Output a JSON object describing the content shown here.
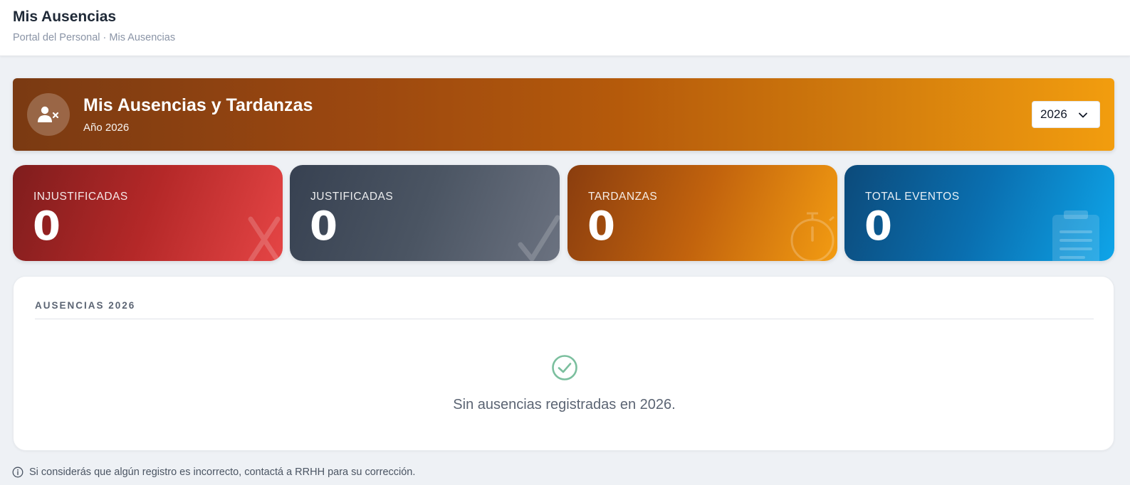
{
  "header": {
    "title": "Mis Ausencias",
    "breadcrumb": "Portal del Personal · Mis Ausencias"
  },
  "hero": {
    "icon": "user-x-icon",
    "title": "Mis Ausencias y Tardanzas",
    "subtitle": "Año 2026",
    "year_select": {
      "value": "2026"
    }
  },
  "stats": [
    {
      "label": "INJUSTIFICADAS",
      "value": "0",
      "icon": "x-mark-icon",
      "color": "#c53030"
    },
    {
      "label": "JUSTIFICADAS",
      "value": "0",
      "icon": "checkmark-icon",
      "color": "#4b5563"
    },
    {
      "label": "TARDANZAS",
      "value": "0",
      "icon": "stopwatch-icon",
      "color": "#d97706"
    },
    {
      "label": "TOTAL EVENTOS",
      "value": "0",
      "icon": "clipboard-icon",
      "color": "#0369a1"
    }
  ],
  "panel": {
    "title": "AUSENCIAS 2026",
    "empty_icon": "check-circle-icon",
    "empty_text": "Sin ausencias registradas en 2026."
  },
  "footnote": {
    "icon": "info-icon",
    "text": "Si considerás que algún registro es incorrecto, contactá a RRHH para su corrección."
  }
}
